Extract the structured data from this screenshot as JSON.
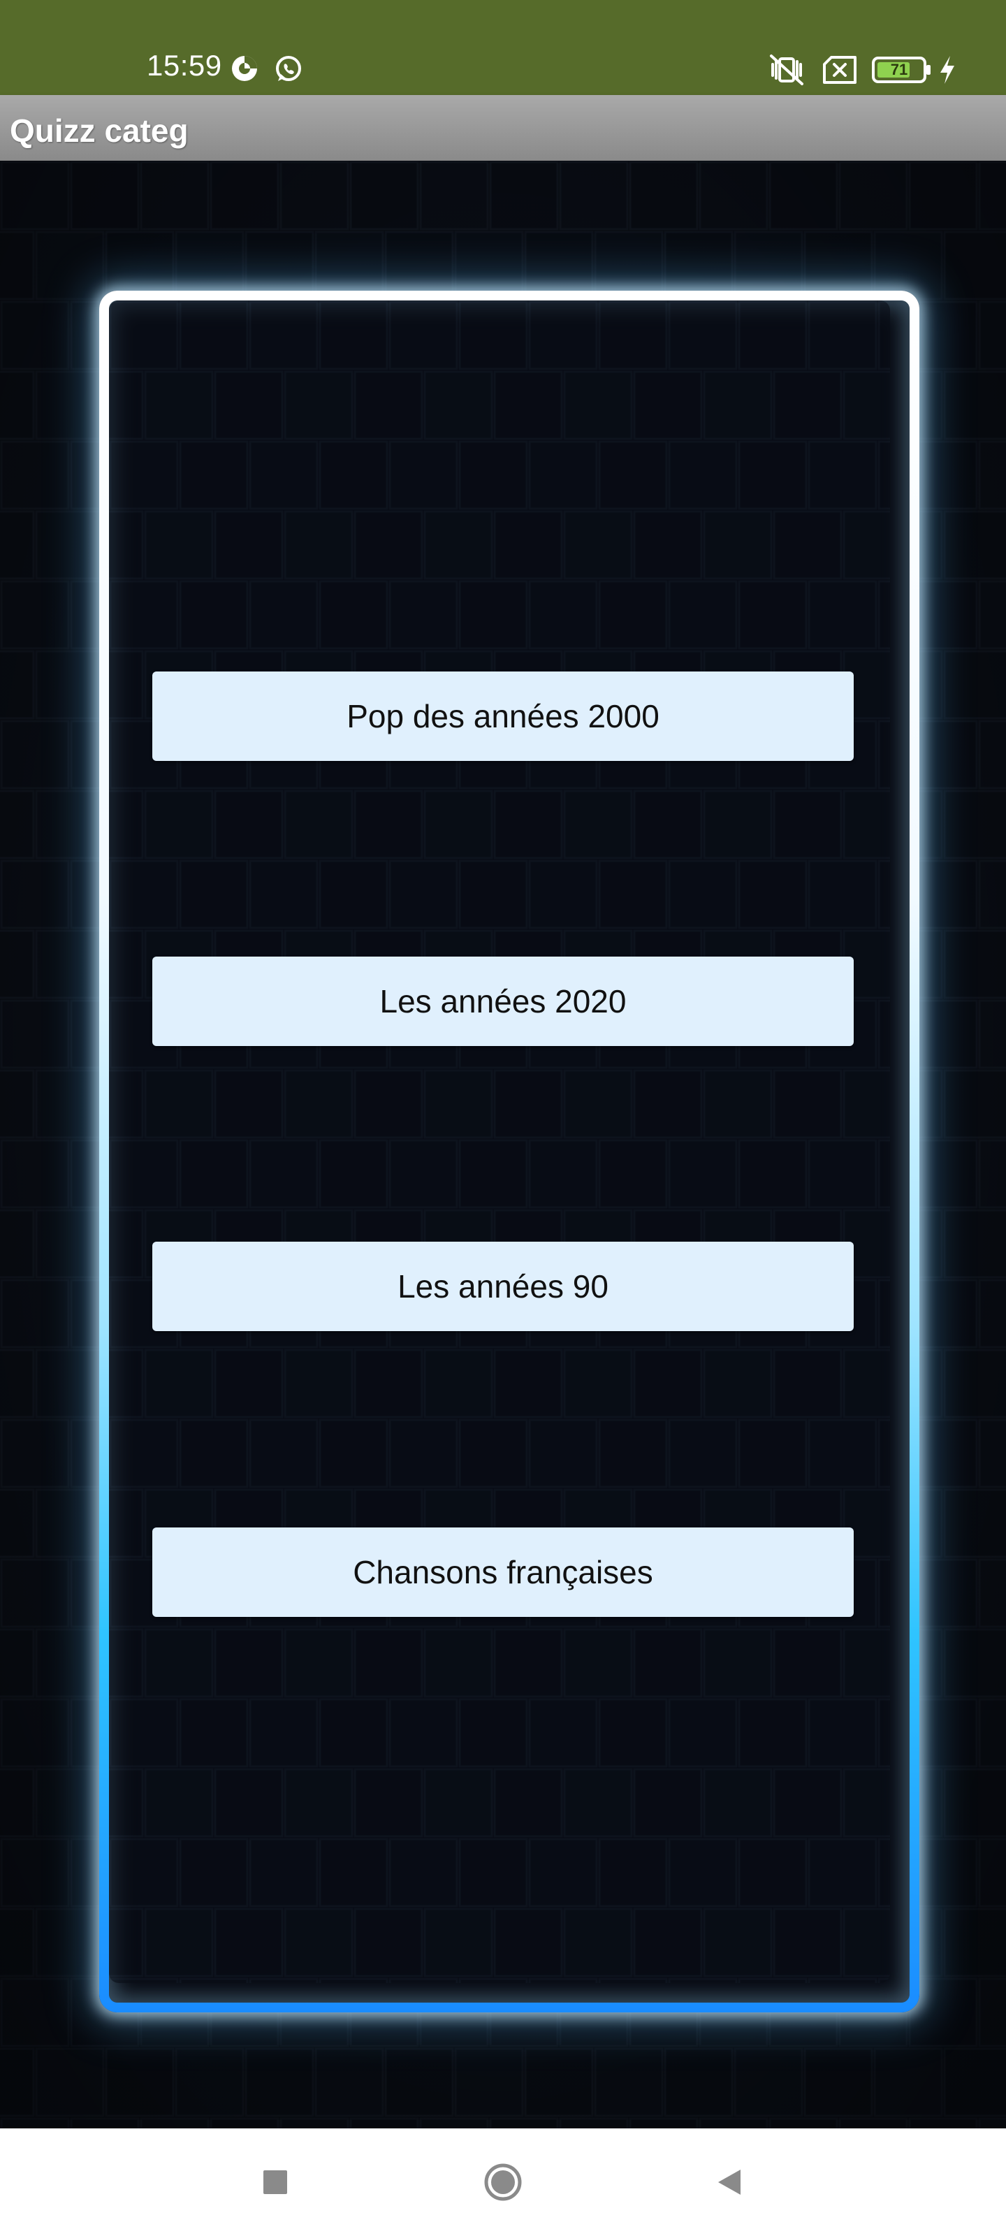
{
  "status_bar": {
    "time": "15:59",
    "battery_level": "71",
    "icons": [
      "data-saver-icon",
      "whatsapp-icon",
      "mute-vibrate-icon",
      "no-sim-icon",
      "battery-icon",
      "charging-bolt-icon"
    ],
    "background_color": "#566b2a"
  },
  "app_bar": {
    "title": "Quizz categ"
  },
  "categories": [
    {
      "label": "Pop des années 2000"
    },
    {
      "label": "Les années 2020"
    },
    {
      "label": "Les années 90"
    },
    {
      "label": "Chansons françaises"
    }
  ],
  "theme": {
    "button_bg": "#e0f0fd",
    "neon_top": "#ffffff",
    "neon_bottom": "#1a8cff",
    "wall_color": "#070a12"
  },
  "nav_bar": {
    "icons": [
      "recents-square-icon",
      "home-circle-icon",
      "back-triangle-icon"
    ]
  }
}
